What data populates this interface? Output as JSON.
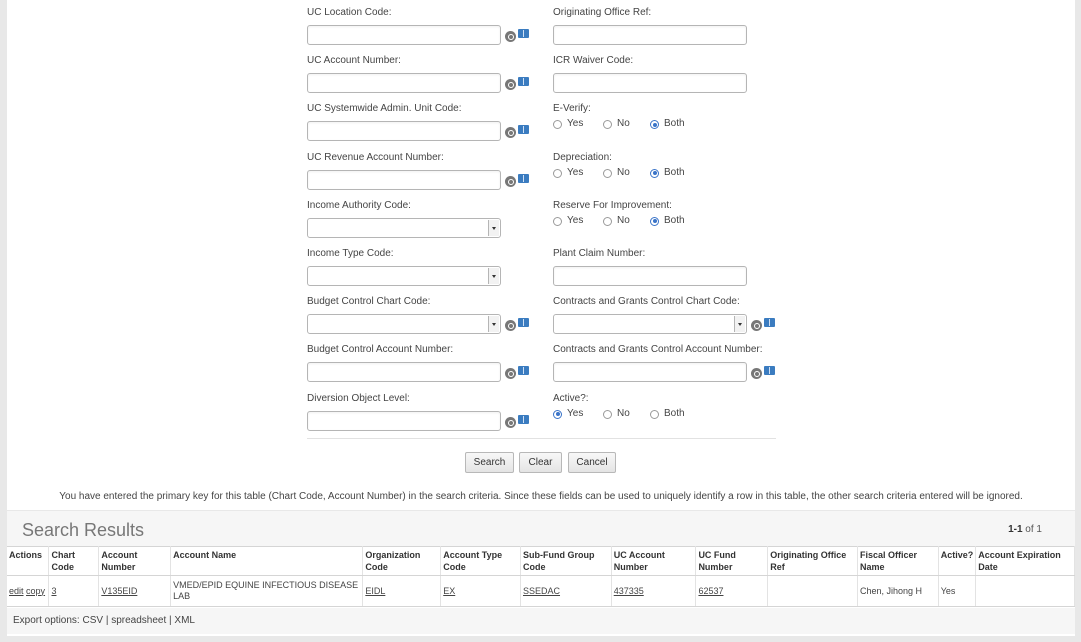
{
  "form": {
    "left": [
      {
        "label": "UC Location Code:",
        "type": "text",
        "value": "",
        "lookup": true
      },
      {
        "label": "UC Account Number:",
        "type": "text",
        "value": "",
        "lookup": true
      },
      {
        "label": "UC Systemwide Admin. Unit Code:",
        "type": "text",
        "value": "",
        "lookup": true
      },
      {
        "label": "UC Revenue Account Number:",
        "type": "text",
        "value": "",
        "lookup": true
      },
      {
        "label": "Income Authority Code:",
        "type": "select",
        "value": "",
        "lookup": false
      },
      {
        "label": "Income Type Code:",
        "type": "select",
        "value": "",
        "lookup": false
      },
      {
        "label": "Budget Control Chart Code:",
        "type": "select",
        "value": "",
        "lookup": true
      },
      {
        "label": "Budget Control Account Number:",
        "type": "text",
        "value": "",
        "lookup": true
      },
      {
        "label": "Diversion Object Level:",
        "type": "text",
        "value": "",
        "lookup": true
      }
    ],
    "right": [
      {
        "label": "Originating Office Ref:",
        "type": "text",
        "value": "",
        "lookup": false
      },
      {
        "label": "ICR Waiver Code:",
        "type": "text",
        "value": "",
        "lookup": false
      },
      {
        "label": "E-Verify:",
        "type": "radio",
        "options": [
          "Yes",
          "No",
          "Both"
        ],
        "selected": "Both"
      },
      {
        "label": "Depreciation:",
        "type": "radio",
        "options": [
          "Yes",
          "No",
          "Both"
        ],
        "selected": "Both"
      },
      {
        "label": "Reserve For Improvement:",
        "type": "radio",
        "options": [
          "Yes",
          "No",
          "Both"
        ],
        "selected": "Both"
      },
      {
        "label": "Plant Claim Number:",
        "type": "text",
        "value": "",
        "lookup": false
      },
      {
        "label": "Contracts and Grants Control Chart Code:",
        "type": "select",
        "value": "",
        "lookup": true
      },
      {
        "label": "Contracts and Grants Control Account Number:",
        "type": "text",
        "value": "",
        "lookup": true
      },
      {
        "label": "Active?:",
        "type": "radio",
        "options": [
          "Yes",
          "No",
          "Both"
        ],
        "selected": "Yes"
      }
    ]
  },
  "buttons": {
    "search": "Search",
    "clear": "Clear",
    "cancel": "Cancel"
  },
  "notice": "You have entered the primary key for this table (Chart Code, Account Number) in the search criteria. Since these fields can be used to uniquely identify a row in this table, the other search criteria entered will be ignored.",
  "results": {
    "title": "Search Results",
    "pager_range": "1-1",
    "pager_suffix": " of 1",
    "columns": [
      "Actions",
      "Chart Code",
      "Account Number",
      "Account Name",
      "Organization Code",
      "Account Type Code",
      "Sub-Fund Group Code",
      "UC Account Number",
      "UC Fund Number",
      "Originating Office Ref",
      "Fiscal Officer Name",
      "Active?",
      "Account Expiration Date"
    ],
    "rows": [
      {
        "actions": [
          "edit",
          "copy"
        ],
        "chart_code": "3",
        "account_number": "V135EID",
        "account_name": "VMED/EPID EQUINE INFECTIOUS DISEASE LAB",
        "organization_code": "EIDL",
        "account_type_code": "EX",
        "sub_fund_group_code": "SSEDAC",
        "uc_account_number": "437335",
        "uc_fund_number": "62537",
        "originating_office_ref": "",
        "fiscal_officer_name": "Chen, Jihong H",
        "active": "Yes",
        "account_expiration_date": ""
      }
    ]
  },
  "export": {
    "label": "Export options:",
    "options": [
      "CSV",
      "spreadsheet",
      "XML"
    ],
    "separator": " | "
  },
  "colors": {
    "radio_selected": "#3a74c8",
    "book_icon": "#3b7cc0",
    "lookup_icon": "#777777"
  }
}
